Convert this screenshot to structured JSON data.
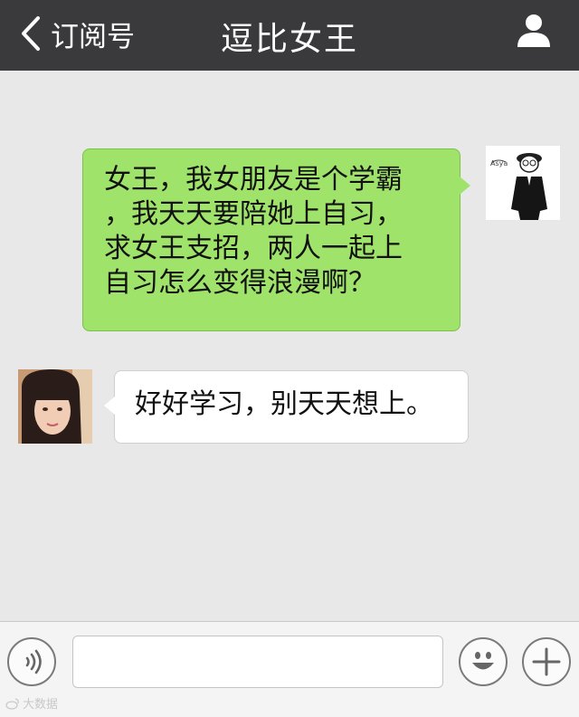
{
  "header": {
    "back_label": "订阅号",
    "title": "逗比女王"
  },
  "messages": [
    {
      "direction": "outgoing",
      "lines": [
        "女王，我女朋友是个学霸",
        "，我天天要陪她上自习，",
        "求女王支招，两人一起上",
        "自习怎么变得浪漫啊？"
      ],
      "avatar": "user-avatar",
      "bubble_color": "#9fe36b"
    },
    {
      "direction": "incoming",
      "lines": [
        "好好学习，别天天想上。"
      ],
      "avatar": "queen-avatar",
      "bubble_color": "#ffffff"
    }
  ],
  "input_bar": {
    "text_value": "",
    "icons": [
      "voice-icon",
      "emoji-icon",
      "plus-icon"
    ]
  },
  "watermark": {
    "text": "大数据"
  },
  "colors": {
    "header_bg": "#3a3a3c",
    "chat_bg": "#e8e8e8",
    "input_bg": "#f4f4f4"
  }
}
